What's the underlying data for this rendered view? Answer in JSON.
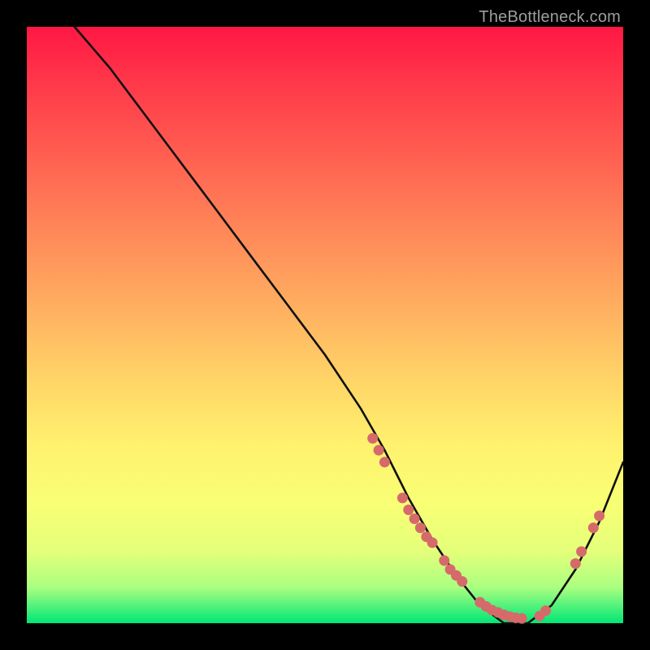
{
  "watermark": "TheBottleneck.com",
  "chart_data": {
    "type": "line",
    "title": "",
    "xlabel": "",
    "ylabel": "",
    "xlim": [
      0,
      100
    ],
    "ylim": [
      0,
      100
    ],
    "grid": false,
    "legend": false,
    "series": [
      {
        "name": "bottleneck-curve",
        "x": [
          8,
          14,
          20,
          26,
          32,
          38,
          44,
          50,
          56,
          60,
          64,
          68,
          72,
          76,
          80,
          84,
          88,
          92,
          96,
          100
        ],
        "y": [
          100,
          93,
          85,
          77,
          69,
          61,
          53,
          45,
          36,
          29,
          21,
          14,
          8,
          3,
          0,
          0,
          3,
          9,
          17,
          27
        ]
      }
    ],
    "scatter_highlights": {
      "name": "highlight-dots",
      "points": [
        {
          "x": 58,
          "y": 31
        },
        {
          "x": 59,
          "y": 29
        },
        {
          "x": 60,
          "y": 27
        },
        {
          "x": 63,
          "y": 21
        },
        {
          "x": 64,
          "y": 19
        },
        {
          "x": 65,
          "y": 17.5
        },
        {
          "x": 66,
          "y": 16
        },
        {
          "x": 67,
          "y": 14.5
        },
        {
          "x": 68,
          "y": 13.5
        },
        {
          "x": 70,
          "y": 10.5
        },
        {
          "x": 71,
          "y": 9
        },
        {
          "x": 72,
          "y": 8
        },
        {
          "x": 73,
          "y": 7
        },
        {
          "x": 76,
          "y": 3.5
        },
        {
          "x": 77,
          "y": 2.8
        },
        {
          "x": 78,
          "y": 2.2
        },
        {
          "x": 79,
          "y": 1.8
        },
        {
          "x": 80,
          "y": 1.4
        },
        {
          "x": 81,
          "y": 1.1
        },
        {
          "x": 82,
          "y": 0.9
        },
        {
          "x": 83,
          "y": 0.8
        },
        {
          "x": 86,
          "y": 1.2
        },
        {
          "x": 87,
          "y": 2.1
        },
        {
          "x": 92,
          "y": 10
        },
        {
          "x": 93,
          "y": 12
        },
        {
          "x": 95,
          "y": 16
        },
        {
          "x": 96,
          "y": 18
        }
      ]
    },
    "gradient_colors": {
      "top": "#ff1744",
      "mid": "#ffeb3b",
      "bottom": "#00e676"
    },
    "highlight_dot_color": "#d66a6a",
    "curve_color": "#101010"
  }
}
